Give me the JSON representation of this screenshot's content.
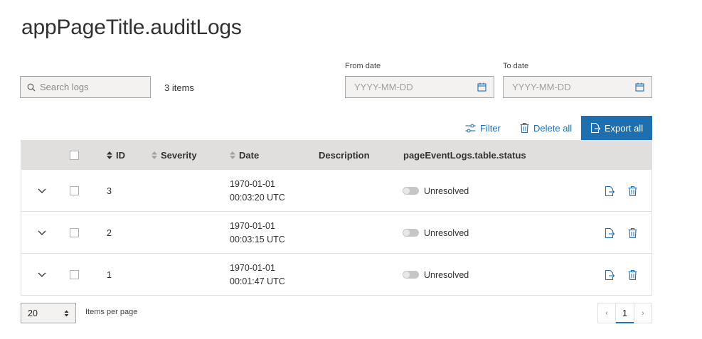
{
  "header": {
    "title": "appPageTitle.auditLogs"
  },
  "search": {
    "placeholder": "Search logs",
    "value": ""
  },
  "items_count": "3 items",
  "date_filters": {
    "from": {
      "label": "From date",
      "placeholder": "YYYY-MM-DD",
      "value": ""
    },
    "to": {
      "label": "To date",
      "placeholder": "YYYY-MM-DD",
      "value": ""
    }
  },
  "toolbar": {
    "filter_label": "Filter",
    "delete_all_label": "Delete all",
    "export_all_label": "Export all"
  },
  "table": {
    "columns": {
      "id": "ID",
      "severity": "Severity",
      "date": "Date",
      "description": "Description",
      "status": "pageEventLogs.table.status"
    },
    "rows": [
      {
        "id": "3",
        "severity": "",
        "date": "1970-01-01",
        "time": "00:03:20 UTC",
        "description": "",
        "status": "Unresolved",
        "resolved": false
      },
      {
        "id": "2",
        "severity": "",
        "date": "1970-01-01",
        "time": "00:03:15 UTC",
        "description": "",
        "status": "Unresolved",
        "resolved": false
      },
      {
        "id": "1",
        "severity": "",
        "date": "1970-01-01",
        "time": "00:01:47 UTC",
        "description": "",
        "status": "Unresolved",
        "resolved": false
      }
    ]
  },
  "pagination": {
    "per_page_value": "20",
    "per_page_label": "Items per page",
    "current_page": "1"
  },
  "colors": {
    "accent": "#1e6fb0",
    "header_bg": "#e1dfdd",
    "input_bg": "#f3f2f1"
  }
}
